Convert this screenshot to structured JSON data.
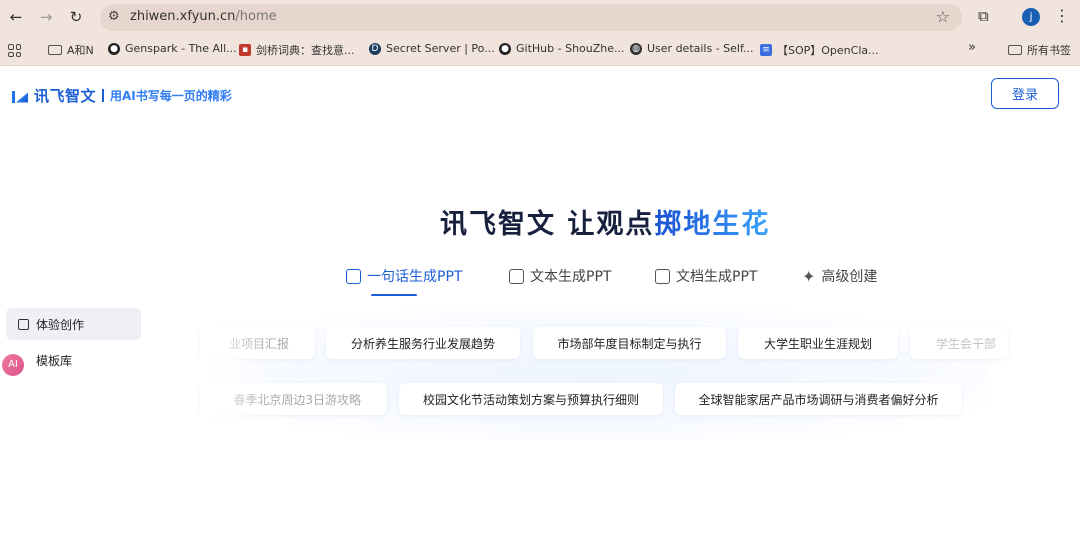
{
  "browser": {
    "url_host": "zhiwen.xfyun.cn",
    "url_path": "/home",
    "profile_initial": "j",
    "bookmarks": [
      {
        "label": "A和N",
        "icon": "folder-icon"
      },
      {
        "label": "Genspark - The All...",
        "icon": "genspark-icon"
      },
      {
        "label": "剑桥词典：查找意...",
        "icon": "cambridge-icon"
      },
      {
        "label": "Secret Server | Po...",
        "icon": "secret-server-icon"
      },
      {
        "label": "GitHub - ShouZhe...",
        "icon": "github-icon"
      },
      {
        "label": "User details - Self...",
        "icon": "globe-icon"
      },
      {
        "label": "【SOP】OpenCla...",
        "icon": "doc-icon"
      }
    ],
    "more_bookmarks": "»",
    "all_bookmarks": "所有书签"
  },
  "header": {
    "logo_name": "讯飞智文",
    "slogan": "用AI书写每一页的精彩",
    "login_label": "登录"
  },
  "hero": {
    "title_plain": "讯飞智文 让观点",
    "title_highlight": "掷地生花"
  },
  "tabs": [
    {
      "label": "一句话生成PPT",
      "icon": "chat-check-icon",
      "active": true
    },
    {
      "label": "文本生成PPT",
      "icon": "doc-check-icon",
      "active": false
    },
    {
      "label": "文档生成PPT",
      "icon": "folder-check-icon",
      "active": false
    },
    {
      "label": "高级创建",
      "icon": "sparkle-icon",
      "active": false
    }
  ],
  "sidebar": {
    "items": [
      {
        "label": "体验创作",
        "icon": "edit-icon",
        "active": true
      },
      {
        "label": "模板库",
        "icon": "template-icon",
        "active": false
      }
    ]
  },
  "prompts": {
    "row1": [
      "业项目汇报",
      "分析养生服务行业发展趋势",
      "市场部年度目标制定与执行",
      "大学生职业生涯规划",
      "学生会干部"
    ],
    "row2": [
      "春季北京周边3日游攻略",
      "校园文化节活动策划方案与预算执行细则",
      "全球智能家居产品市场调研与消费者偏好分析"
    ]
  },
  "colors": {
    "brand": "#1b5ed6",
    "chrome": "#f1e4dc"
  }
}
